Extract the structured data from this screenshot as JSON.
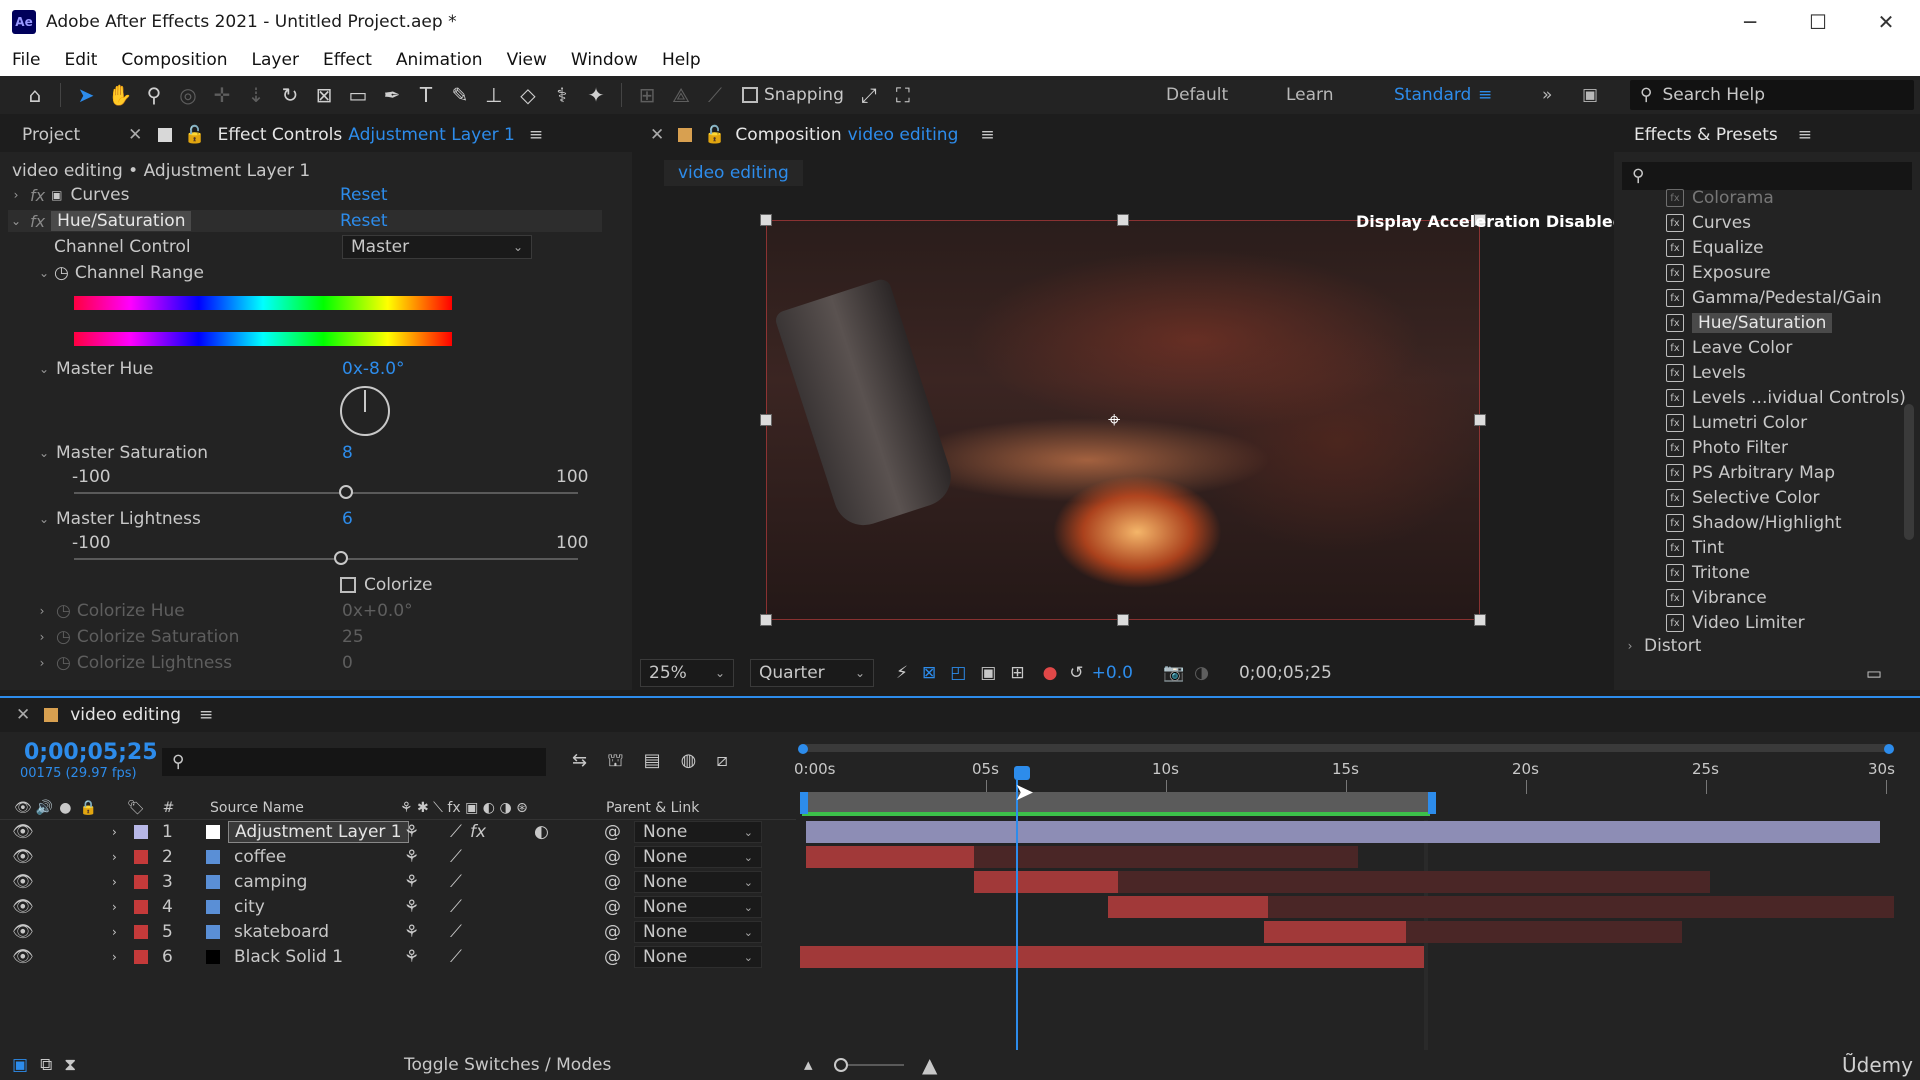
{
  "window": {
    "title": "Adobe After Effects 2021 - Untitled Project.aep *",
    "logo": "Ae",
    "controls": [
      "─",
      "☐",
      "✕"
    ]
  },
  "menu": [
    "File",
    "Edit",
    "Composition",
    "Layer",
    "Effect",
    "Animation",
    "View",
    "Window",
    "Help"
  ],
  "toolbar": {
    "snapping_label": "Snapping",
    "workspaces": {
      "default": "Default",
      "learn": "Learn",
      "standard": "Standard"
    },
    "search_placeholder": "Search Help"
  },
  "project_panel": {
    "tab_project": "Project",
    "tab_effect_controls": "Effect Controls",
    "tab_effect_controls_layer": "Adjustment Layer 1",
    "breadcrumb": "video editing • Adjustment Layer 1",
    "effects": [
      {
        "name": "Curves",
        "reset": "Reset"
      },
      {
        "name": "Hue/Saturation",
        "reset": "Reset"
      }
    ],
    "channel_control_label": "Channel Control",
    "channel_control_value": "Master",
    "channel_range_label": "Channel Range",
    "master_hue_label": "Master Hue",
    "master_hue_value": "0x-8.0°",
    "master_saturation_label": "Master Saturation",
    "master_saturation_value": "8",
    "master_saturation": 8,
    "master_lightness_label": "Master Lightness",
    "master_lightness_value": "6",
    "master_lightness": 6,
    "range_min": "-100",
    "range_max": "100",
    "colorize_label": "Colorize",
    "colorize_hue_label": "Colorize Hue",
    "colorize_hue_value": "0x+0.0°",
    "colorize_saturation_label": "Colorize Saturation",
    "colorize_saturation_value": "25",
    "colorize_lightness_label": "Colorize Lightness",
    "colorize_lightness_value": "0"
  },
  "composition": {
    "tab_label": "Composition",
    "comp_name": "video editing",
    "sub_tab": "video editing",
    "overlay": "Display Acceleration Disabled",
    "zoom": "25%",
    "resolution": "Quarter",
    "exposure": "+0.0",
    "timecode": "0;00;05;25"
  },
  "effects_presets": {
    "title": "Effects & Presets",
    "items": [
      "Colorama",
      "Curves",
      "Equalize",
      "Exposure",
      "Gamma/Pedestal/Gain",
      "Hue/Saturation",
      "Leave Color",
      "Levels",
      "Levels ...ividual Controls)",
      "Lumetri Color",
      "Photo Filter",
      "PS Arbitrary Map",
      "Selective Color",
      "Shadow/Highlight",
      "Tint",
      "Tritone",
      "Vibrance",
      "Video Limiter"
    ],
    "selected": "Hue/Saturation",
    "category": "Distort"
  },
  "timeline": {
    "comp_name": "video editing",
    "timecode": "0;00;05;25",
    "frame_info": "00175 (29.97 fps)",
    "col_source_name": "Source Name",
    "col_parent_link": "Parent & Link",
    "col_hash": "#",
    "layers": [
      {
        "num": "1",
        "name": "Adjustment Layer 1",
        "parent": "None",
        "color": "#b7b7e6"
      },
      {
        "num": "2",
        "name": "coffee",
        "parent": "None",
        "color": "#c43a3a"
      },
      {
        "num": "3",
        "name": "camping",
        "parent": "None",
        "color": "#c43a3a"
      },
      {
        "num": "4",
        "name": "city",
        "parent": "None",
        "color": "#c43a3a"
      },
      {
        "num": "5",
        "name": "skateboard",
        "parent": "None",
        "color": "#c43a3a"
      },
      {
        "num": "6",
        "name": "Black Solid 1",
        "parent": "None",
        "color": "#c43a3a"
      }
    ],
    "ruler": [
      "0:00s",
      "05s",
      "10s",
      "15s",
      "20s",
      "25s",
      "30s"
    ],
    "toggle_label": "Toggle Switches / Modes"
  },
  "watermark": "Ũdemy"
}
